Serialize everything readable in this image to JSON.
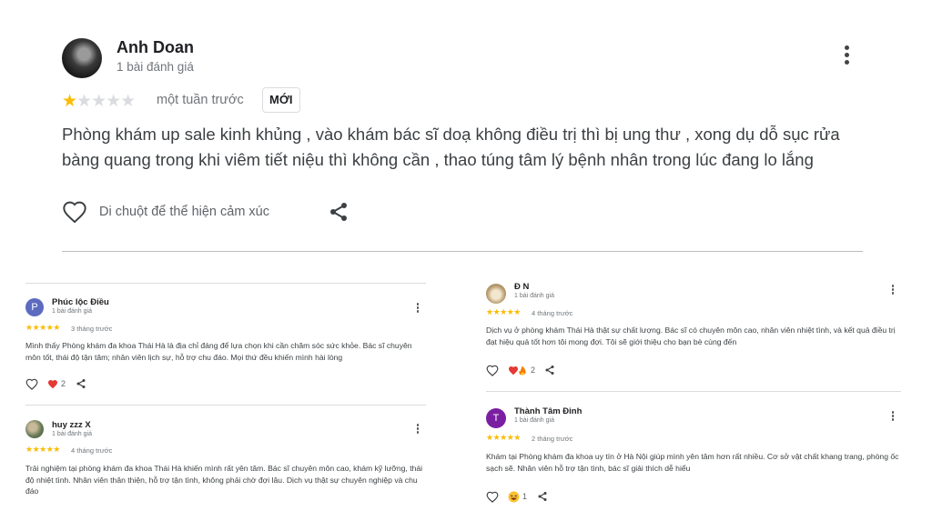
{
  "main_review": {
    "author": "Anh Doan",
    "review_count": "1 bài đánh giá",
    "rating": 1,
    "time": "một tuần trước",
    "badge": "MỚI",
    "text": "Phòng khám up sale kinh khủng , vào khám bác sĩ doạ không điều trị thì bị ung thư , xong dụ dỗ sục rửa bàng quang trong khi viêm tiết niệu thì không cần , thao túng tâm lý bệnh nhân trong lúc đang lo lắng",
    "reaction_hint": "Di chuột để thể hiện cảm xúc",
    "icons": [
      "more-vert-icon",
      "heart-outline-icon",
      "share-icon"
    ]
  },
  "reviews": [
    {
      "author": "Phúc lộc Điều",
      "avatar_letter": "P",
      "avatar_color": "#5c6bc0",
      "review_count": "1 bài đánh giá",
      "rating": 5,
      "time": "3 tháng trước",
      "text": "Mình thấy Phòng khám đa khoa Thái Hà là địa chỉ đáng để lựa chọn khi cần chăm sóc sức khỏe. Bác sĩ chuyên môn tốt, thái độ tận tâm; nhân viên lịch sự, hỗ trợ chu đáo. Mọi thứ đều khiến mình hài lòng",
      "reaction_count": "2",
      "reaction_icon": "red-heart-icon"
    },
    {
      "author": "huy zzz X",
      "avatar_letter": "",
      "avatar_color": "#7a8a6a",
      "review_count": "1 bài đánh giá",
      "rating": 5,
      "time": "4 tháng trước",
      "text": "Trải nghiệm tại phòng khám đa khoa Thái Hà khiến mình rất yên tâm. Bác sĩ chuyên môn cao, khám kỹ lưỡng, thái độ nhiệt tình. Nhân viên thân thiện, hỗ trợ tận tình, không phải chờ đợi lâu. Dịch vụ thật sự chuyên nghiệp và chu đáo"
    },
    {
      "author": "Đ N",
      "avatar_letter": "",
      "avatar_color": "#c9b28a",
      "review_count": "1 bài đánh giá",
      "rating": 5,
      "time": "4 tháng trước",
      "text": "Dịch vụ ở phòng khám Thái Hà thật sự chất lượng. Bác sĩ có chuyên môn cao, nhân viên nhiệt tình, và kết quả điều trị đạt hiệu quả tốt hơn tôi mong đợi. Tôi sẽ giới thiệu cho bạn bè cùng đến",
      "reaction_count": "2",
      "reaction_icon": "heart-fire-icon"
    },
    {
      "author": "Thành Tâm Đinh",
      "avatar_letter": "T",
      "avatar_color": "#7b1fa2",
      "review_count": "1 bài đánh giá",
      "rating": 5,
      "time": "2 tháng trước",
      "text": "Khám tại Phòng khám đa khoa uy tín ở Hà Nội giúp mình yên tâm hơn rất nhiều. Cơ sở vật chất khang trang, phòng ốc sạch sẽ. Nhân viên hỗ trợ tận tình, bác sĩ giải thích dễ hiểu",
      "reaction_count": "1",
      "reaction_icon": "laughing-emoji-icon"
    }
  ]
}
